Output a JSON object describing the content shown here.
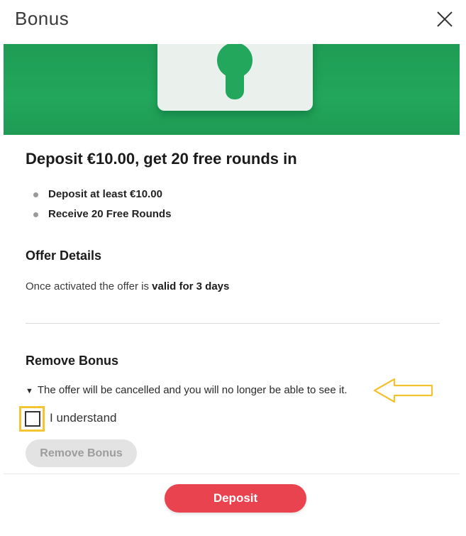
{
  "header": {
    "title": "Bonus"
  },
  "offer": {
    "headline": "Deposit €10.00, get 20 free rounds in",
    "bullets": [
      {
        "text": "Deposit at least €10.00"
      },
      {
        "text": "Receive 20 Free Rounds"
      }
    ]
  },
  "details": {
    "title": "Offer Details",
    "text_prefix": "Once activated the offer is ",
    "text_bold": "valid for 3 days"
  },
  "remove": {
    "title": "Remove Bonus",
    "warning": "The offer will be cancelled and you will no longer be able to see it.",
    "checkbox_label": "I understand",
    "checkbox_checked": false,
    "button_label": "Remove Bonus"
  },
  "footer": {
    "deposit_label": "Deposit"
  },
  "colors": {
    "banner_green": "#22a75c",
    "deposit_red": "#ea4350",
    "highlight_yellow": "#f4c531",
    "disabled_gray": "#e3e3e3"
  },
  "icons": {
    "close": "close-icon",
    "lock": "lock-icon",
    "arrow": "arrow-left-icon",
    "warning_toggle": "triangle-down-icon"
  }
}
